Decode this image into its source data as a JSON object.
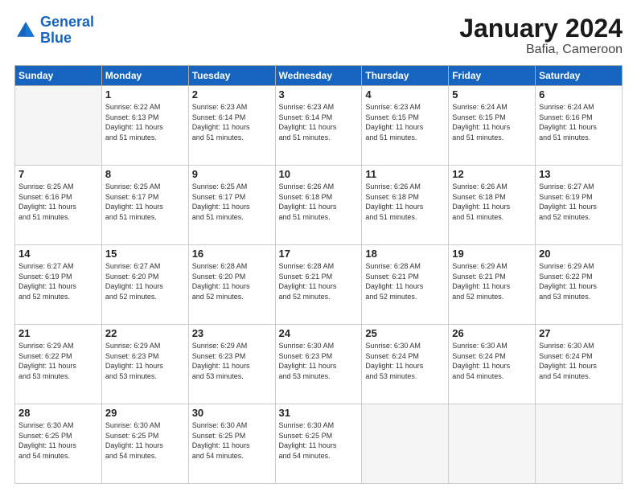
{
  "logo": {
    "line1": "General",
    "line2": "Blue"
  },
  "title": "January 2024",
  "subtitle": "Bafia, Cameroon",
  "days_of_week": [
    "Sunday",
    "Monday",
    "Tuesday",
    "Wednesday",
    "Thursday",
    "Friday",
    "Saturday"
  ],
  "weeks": [
    [
      {
        "day": "",
        "info": ""
      },
      {
        "day": "1",
        "info": "Sunrise: 6:22 AM\nSunset: 6:13 PM\nDaylight: 11 hours\nand 51 minutes."
      },
      {
        "day": "2",
        "info": "Sunrise: 6:23 AM\nSunset: 6:14 PM\nDaylight: 11 hours\nand 51 minutes."
      },
      {
        "day": "3",
        "info": "Sunrise: 6:23 AM\nSunset: 6:14 PM\nDaylight: 11 hours\nand 51 minutes."
      },
      {
        "day": "4",
        "info": "Sunrise: 6:23 AM\nSunset: 6:15 PM\nDaylight: 11 hours\nand 51 minutes."
      },
      {
        "day": "5",
        "info": "Sunrise: 6:24 AM\nSunset: 6:15 PM\nDaylight: 11 hours\nand 51 minutes."
      },
      {
        "day": "6",
        "info": "Sunrise: 6:24 AM\nSunset: 6:16 PM\nDaylight: 11 hours\nand 51 minutes."
      }
    ],
    [
      {
        "day": "7",
        "info": "Sunrise: 6:25 AM\nSunset: 6:16 PM\nDaylight: 11 hours\nand 51 minutes."
      },
      {
        "day": "8",
        "info": "Sunrise: 6:25 AM\nSunset: 6:17 PM\nDaylight: 11 hours\nand 51 minutes."
      },
      {
        "day": "9",
        "info": "Sunrise: 6:25 AM\nSunset: 6:17 PM\nDaylight: 11 hours\nand 51 minutes."
      },
      {
        "day": "10",
        "info": "Sunrise: 6:26 AM\nSunset: 6:18 PM\nDaylight: 11 hours\nand 51 minutes."
      },
      {
        "day": "11",
        "info": "Sunrise: 6:26 AM\nSunset: 6:18 PM\nDaylight: 11 hours\nand 51 minutes."
      },
      {
        "day": "12",
        "info": "Sunrise: 6:26 AM\nSunset: 6:18 PM\nDaylight: 11 hours\nand 51 minutes."
      },
      {
        "day": "13",
        "info": "Sunrise: 6:27 AM\nSunset: 6:19 PM\nDaylight: 11 hours\nand 52 minutes."
      }
    ],
    [
      {
        "day": "14",
        "info": "Sunrise: 6:27 AM\nSunset: 6:19 PM\nDaylight: 11 hours\nand 52 minutes."
      },
      {
        "day": "15",
        "info": "Sunrise: 6:27 AM\nSunset: 6:20 PM\nDaylight: 11 hours\nand 52 minutes."
      },
      {
        "day": "16",
        "info": "Sunrise: 6:28 AM\nSunset: 6:20 PM\nDaylight: 11 hours\nand 52 minutes."
      },
      {
        "day": "17",
        "info": "Sunrise: 6:28 AM\nSunset: 6:21 PM\nDaylight: 11 hours\nand 52 minutes."
      },
      {
        "day": "18",
        "info": "Sunrise: 6:28 AM\nSunset: 6:21 PM\nDaylight: 11 hours\nand 52 minutes."
      },
      {
        "day": "19",
        "info": "Sunrise: 6:29 AM\nSunset: 6:21 PM\nDaylight: 11 hours\nand 52 minutes."
      },
      {
        "day": "20",
        "info": "Sunrise: 6:29 AM\nSunset: 6:22 PM\nDaylight: 11 hours\nand 53 minutes."
      }
    ],
    [
      {
        "day": "21",
        "info": "Sunrise: 6:29 AM\nSunset: 6:22 PM\nDaylight: 11 hours\nand 53 minutes."
      },
      {
        "day": "22",
        "info": "Sunrise: 6:29 AM\nSunset: 6:23 PM\nDaylight: 11 hours\nand 53 minutes."
      },
      {
        "day": "23",
        "info": "Sunrise: 6:29 AM\nSunset: 6:23 PM\nDaylight: 11 hours\nand 53 minutes."
      },
      {
        "day": "24",
        "info": "Sunrise: 6:30 AM\nSunset: 6:23 PM\nDaylight: 11 hours\nand 53 minutes."
      },
      {
        "day": "25",
        "info": "Sunrise: 6:30 AM\nSunset: 6:24 PM\nDaylight: 11 hours\nand 53 minutes."
      },
      {
        "day": "26",
        "info": "Sunrise: 6:30 AM\nSunset: 6:24 PM\nDaylight: 11 hours\nand 54 minutes."
      },
      {
        "day": "27",
        "info": "Sunrise: 6:30 AM\nSunset: 6:24 PM\nDaylight: 11 hours\nand 54 minutes."
      }
    ],
    [
      {
        "day": "28",
        "info": "Sunrise: 6:30 AM\nSunset: 6:25 PM\nDaylight: 11 hours\nand 54 minutes."
      },
      {
        "day": "29",
        "info": "Sunrise: 6:30 AM\nSunset: 6:25 PM\nDaylight: 11 hours\nand 54 minutes."
      },
      {
        "day": "30",
        "info": "Sunrise: 6:30 AM\nSunset: 6:25 PM\nDaylight: 11 hours\nand 54 minutes."
      },
      {
        "day": "31",
        "info": "Sunrise: 6:30 AM\nSunset: 6:25 PM\nDaylight: 11 hours\nand 54 minutes."
      },
      {
        "day": "",
        "info": ""
      },
      {
        "day": "",
        "info": ""
      },
      {
        "day": "",
        "info": ""
      }
    ]
  ]
}
